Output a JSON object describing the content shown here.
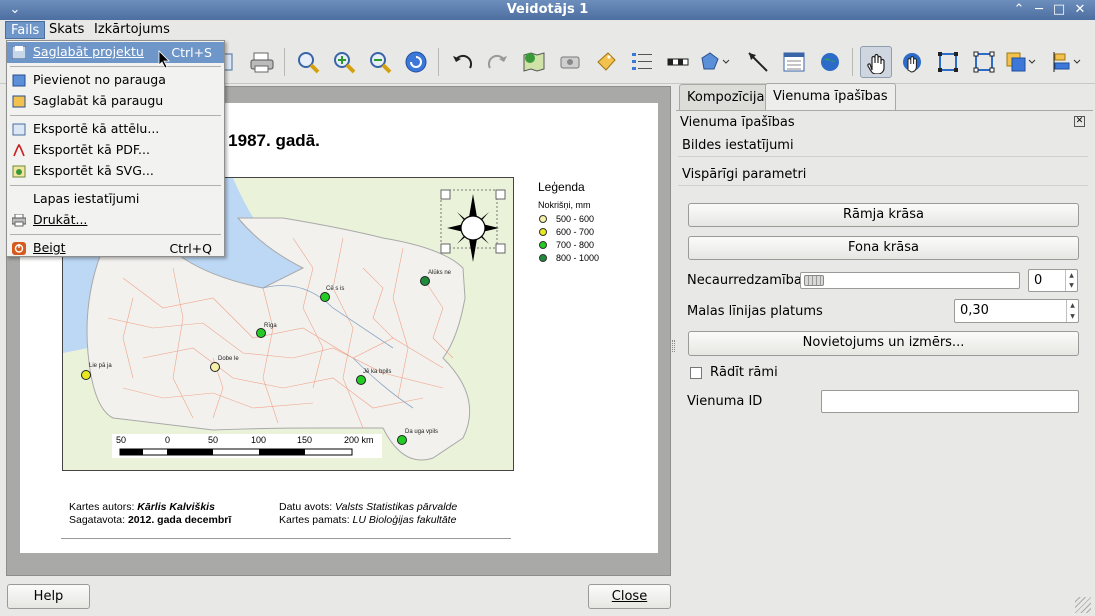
{
  "window": {
    "title": "Veidotājs 1",
    "controls": [
      "up",
      "minimize",
      "maximize",
      "close"
    ]
  },
  "menubar": {
    "items": [
      "Fails",
      "Skats",
      "Izkārtojums"
    ]
  },
  "file_menu": {
    "items": [
      {
        "label": "Saglabāt projektu",
        "shortcut": "Ctrl+S",
        "icon": "save-icon"
      },
      {
        "label": "Pievienot no parauga",
        "icon": "template-add-icon"
      },
      {
        "label": "Saglabāt kā paraugu",
        "icon": "template-save-icon"
      },
      {
        "label": "Eksportē kā attēlu...",
        "icon": "export-image-icon"
      },
      {
        "label": "Eksportēt kā PDF...",
        "icon": "pdf-icon"
      },
      {
        "label": "Eksportēt kā SVG...",
        "icon": "svg-icon"
      },
      {
        "label": "Lapas iestatījumi",
        "icon": ""
      },
      {
        "label": "Drukāt...",
        "icon": "printer-icon"
      },
      {
        "label": "Beigt",
        "shortcut": "Ctrl+Q",
        "icon": "quit-icon"
      }
    ]
  },
  "composition": {
    "title": "s 1987. gadā.",
    "legend": {
      "title": "Leģenda",
      "subtitle": "Nokrišņi, mm",
      "entries": [
        {
          "label": "500 - 600",
          "color": "#f7f0a8"
        },
        {
          "label": "600 - 700",
          "color": "#e8e820"
        },
        {
          "label": "700 - 800",
          "color": "#22cc22"
        },
        {
          "label": "800 - 1000",
          "color": "#1e8a3c"
        }
      ]
    },
    "cities": [
      {
        "name": "Alūks ne",
        "class": 3
      },
      {
        "name": "Cē s is",
        "class": 2
      },
      {
        "name": "Rīga",
        "class": 2
      },
      {
        "name": "Dobe le",
        "class": 0
      },
      {
        "name": "Lie pā ja",
        "class": 1
      },
      {
        "name": "Jē ka bpils",
        "class": 2
      },
      {
        "name": "Da uga vpils",
        "class": 2
      }
    ],
    "scalebar": {
      "labels": [
        "50",
        "0",
        "50",
        "100",
        "150",
        "200 km"
      ]
    },
    "footer": {
      "author_label": "Kartes autors:",
      "author": "Kārlis Kalviškis",
      "prepared_label": "Sagatavota:",
      "prepared": "2012. gada decembrī",
      "source_label": "Datu avots:",
      "source": "Valsts Statistikas pārvalde",
      "base_label": "Kartes pamats:",
      "base": "LU Bioloģijas fakultāte"
    }
  },
  "panel": {
    "tabs": [
      "Kompozīcija",
      "Vienuma īpašības"
    ],
    "active_tab": "Vienuma īpašības",
    "header": "Vienuma īpašības",
    "sections": [
      "Bildes iestatījumi",
      "Vispārīgi parametri"
    ],
    "frame_color_button": "Rāmja krāsa",
    "bg_color_button": "Fona krāsa",
    "opacity_label": "Necaurredzamība",
    "opacity_value": "0",
    "outline_label": "Malas līnijas platums",
    "outline_value": "0,30",
    "position_button": "Novietojums un izmērs...",
    "show_frame_label": "Rādīt rāmi",
    "show_frame_checked": false,
    "item_id_label": "Vienuma ID",
    "item_id_value": ""
  },
  "bottom": {
    "help": "Help",
    "close": "Close"
  }
}
